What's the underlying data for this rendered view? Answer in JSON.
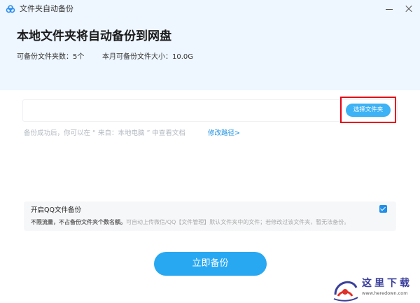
{
  "titlebar": {
    "title": "文件夹自动备份"
  },
  "header": {
    "heading": "本地文件夹将自动备份到网盘",
    "folder_count_text": "可备份文件夹数：5个",
    "monthly_size_text": "本月可备份文件大小：10.0G"
  },
  "path": {
    "value": "",
    "choose_label": "选择文件夹"
  },
  "hint": {
    "text": "备份成功后，你可以在 “ 来自：本地电脑 ” 中查看文档",
    "modify_label": "修改路径>"
  },
  "option": {
    "title": "开启QQ文件备份",
    "desc_bold": "不限流量，不占备份文件夹个数名额。",
    "desc_rest": "可自动上传微信/QQ【文件管理】默认文件夹中的文件；若修改过该文件夹，暂无法备份。",
    "checked": true
  },
  "actions": {
    "backup_label": "立即备份"
  },
  "watermark": {
    "text": "这里下载",
    "url": "www.heredown.com"
  },
  "colors": {
    "accent": "#29a8f2",
    "link": "#1a8fe0",
    "highlight": "#e60012",
    "header_bg": "#eef6ff"
  }
}
